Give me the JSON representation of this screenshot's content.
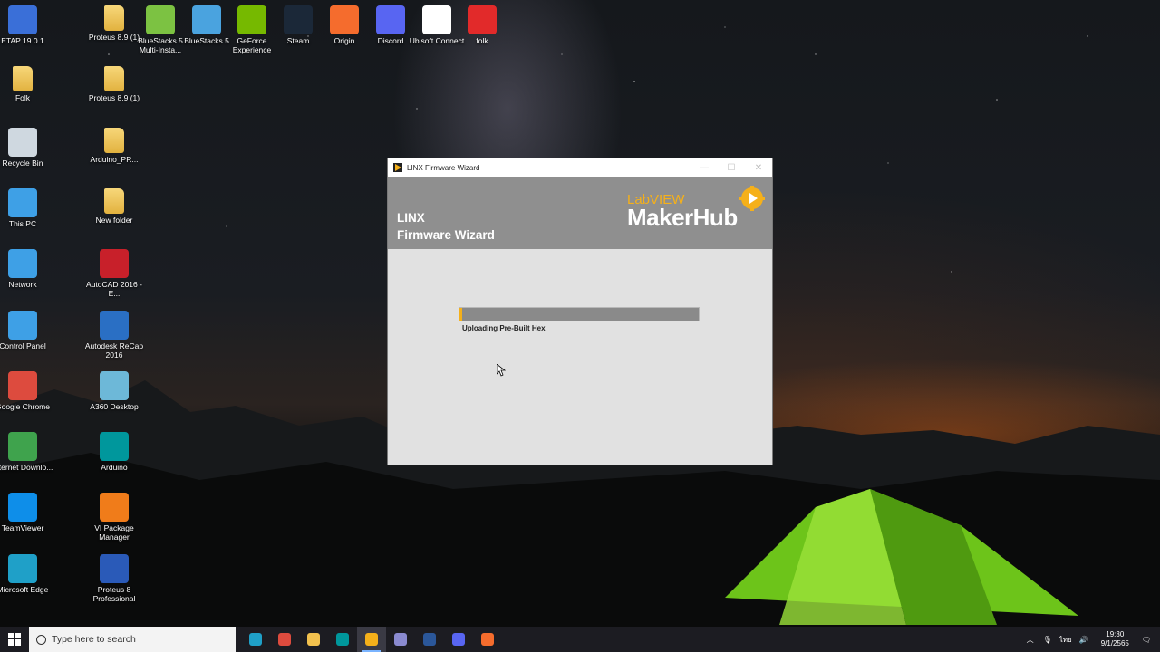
{
  "desktop": {
    "icons": [
      {
        "label": "ETAP 19.0.1",
        "icon": "etap-icon",
        "color": "#3a6fd8"
      },
      {
        "label": "Folk",
        "icon": "folder-user-icon",
        "color": "#e2b23f"
      },
      {
        "label": "Recycle Bin",
        "icon": "recycle-bin-icon",
        "color": "#cfd8e0"
      },
      {
        "label": "This PC",
        "icon": "computer-icon",
        "color": "#3ea0e6"
      },
      {
        "label": "Network",
        "icon": "network-icon",
        "color": "#3ea0e6"
      },
      {
        "label": "Control Panel",
        "icon": "control-panel-icon",
        "color": "#3ea0e6"
      },
      {
        "label": "Google Chrome",
        "icon": "chrome-icon",
        "color": "#dd4b3e"
      },
      {
        "label": "Internet Downlo...",
        "icon": "idm-icon",
        "color": "#3fa34d"
      },
      {
        "label": "TeamViewer",
        "icon": "teamviewer-icon",
        "color": "#0e8ee9"
      },
      {
        "label": "Microsoft Edge",
        "icon": "edge-icon",
        "color": "#1fa0c8"
      },
      {
        "label": "Proteus 8.9 (1)",
        "icon": "folder-icon",
        "color": "#e2b23f"
      },
      {
        "label": "Proteus 8.9 (1)",
        "icon": "folder-icon",
        "color": "#e2b23f"
      },
      {
        "label": "Arduino_PR...",
        "icon": "folder-icon",
        "color": "#e2b23f"
      },
      {
        "label": "New folder",
        "icon": "folder-icon",
        "color": "#e2b23f"
      },
      {
        "label": "AutoCAD 2016 - E...",
        "icon": "autocad-icon",
        "color": "#c8202a"
      },
      {
        "label": "Autodesk ReCap 2016",
        "icon": "recap-icon",
        "color": "#2a6fc4"
      },
      {
        "label": "A360 Desktop",
        "icon": "a360-icon",
        "color": "#6db8d8"
      },
      {
        "label": "Arduino",
        "icon": "arduino-icon",
        "color": "#00979c"
      },
      {
        "label": "VI Package Manager",
        "icon": "vipm-icon",
        "color": "#f07c1a"
      },
      {
        "label": "Proteus 8 Professional",
        "icon": "proteus-icon",
        "color": "#2a5ab8"
      },
      {
        "label": "BlueStacks 5 Multi-Insta...",
        "icon": "bluestacks-multi-icon",
        "color": "#7cc242"
      },
      {
        "label": "BlueStacks 5",
        "icon": "bluestacks-icon",
        "color": "#4aa3df"
      },
      {
        "label": "GeForce Experience",
        "icon": "geforce-icon",
        "color": "#76b900"
      },
      {
        "label": "Steam",
        "icon": "steam-icon",
        "color": "#1b2838"
      },
      {
        "label": "Origin",
        "icon": "origin-icon",
        "color": "#f56c2d"
      },
      {
        "label": "Discord",
        "icon": "discord-icon",
        "color": "#5865f2"
      },
      {
        "label": "Ubisoft Connect",
        "icon": "ubisoft-icon",
        "color": "#ffffff"
      },
      {
        "label": "folk",
        "icon": "no-entry-icon",
        "color": "#e22a2a"
      }
    ]
  },
  "window": {
    "title": "LINX Firmware Wizard",
    "header_line1": "LINX",
    "header_line2": "Firmware Wizard",
    "logo_small": "LabVIEW",
    "logo_big": "MakerHub",
    "progress_fraction": 0.01,
    "status_text": "Uploading Pre-Built Hex",
    "minimize": "—",
    "maximize": "☐",
    "close": "✕"
  },
  "taskbar": {
    "search_placeholder": "Type here to search",
    "apps": [
      {
        "icon": "edge-icon",
        "color": "#1fa0c8",
        "active": false
      },
      {
        "icon": "chrome-icon",
        "color": "#dd4b3e",
        "active": false
      },
      {
        "icon": "file-explorer-icon",
        "color": "#f2c14e",
        "active": false
      },
      {
        "icon": "arduino-icon",
        "color": "#00979c",
        "active": false
      },
      {
        "icon": "linx-icon",
        "color": "#f5b01a",
        "active": true
      },
      {
        "icon": "calculator-icon",
        "color": "#8a8ad0",
        "active": false
      },
      {
        "icon": "word-icon",
        "color": "#2b579a",
        "active": false
      },
      {
        "icon": "discord-icon",
        "color": "#5865f2",
        "active": false
      },
      {
        "icon": "origin-icon",
        "color": "#f56c2d",
        "active": false
      }
    ],
    "lang": "ไทย",
    "time": "19:30",
    "date": "9/1/2565"
  }
}
